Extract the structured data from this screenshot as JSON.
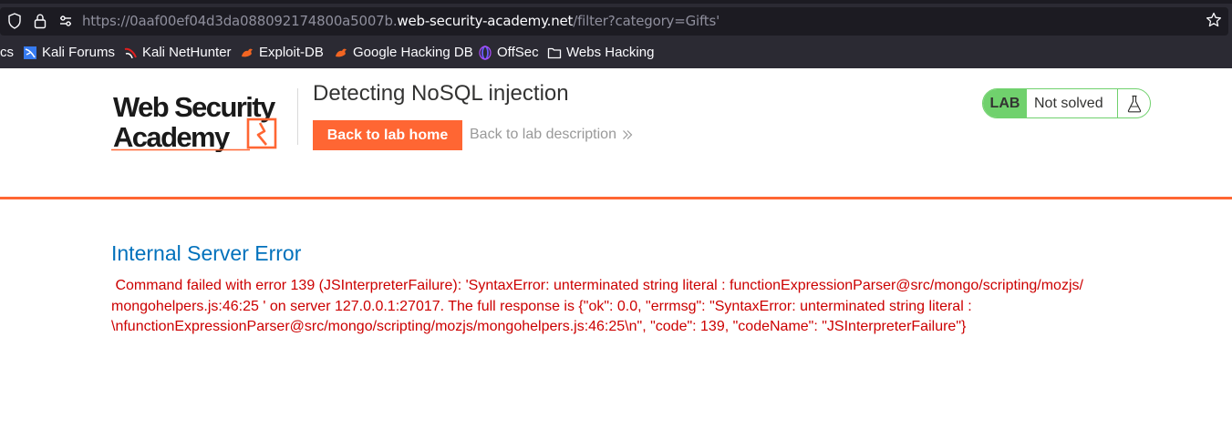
{
  "browser": {
    "url_prefix": "https://0aaf00ef04d3da088092174800a5007b.",
    "url_host": "web-security-academy.net",
    "url_path": "/filter?category=Gifts'",
    "bookmarks": [
      {
        "label": "cs",
        "icon": "none"
      },
      {
        "label": "Kali Forums",
        "icon": "kali-forums-icon"
      },
      {
        "label": "Kali NetHunter",
        "icon": "kali-nethunter-icon"
      },
      {
        "label": "Exploit-DB",
        "icon": "exploit-db-icon"
      },
      {
        "label": "Google Hacking DB",
        "icon": "ghdb-icon"
      },
      {
        "label": "OffSec",
        "icon": "offsec-icon"
      },
      {
        "label": "Webs Hacking",
        "icon": "folder-icon"
      }
    ]
  },
  "header": {
    "lab_title": "Detecting NoSQL injection",
    "back_home_label": "Back to lab home",
    "back_desc_label": "Back to lab description",
    "lab_badge": "LAB",
    "lab_status": "Not solved"
  },
  "error": {
    "title": "Internal Server Error",
    "message": " Command failed with error 139 (JSInterpreterFailure): 'SyntaxError: unterminated string literal : functionExpressionParser@src/mongo/scripting/mozjs/\nmongohelpers.js:46:25 ' on server 127.0.0.1:27017. The full response is {\"ok\": 0.0, \"errmsg\": \"SyntaxError: unterminated string literal :\n\\nfunctionExpressionParser@src/mongo/scripting/mozjs/mongohelpers.js:46:25\\n\", \"code\": 139, \"codeName\": \"JSInterpreterFailure\"}"
  },
  "colors": {
    "accent": "#ff6633",
    "lab_green": "#70d16d",
    "error_title": "#0071bc",
    "error_text": "#cc0000"
  }
}
